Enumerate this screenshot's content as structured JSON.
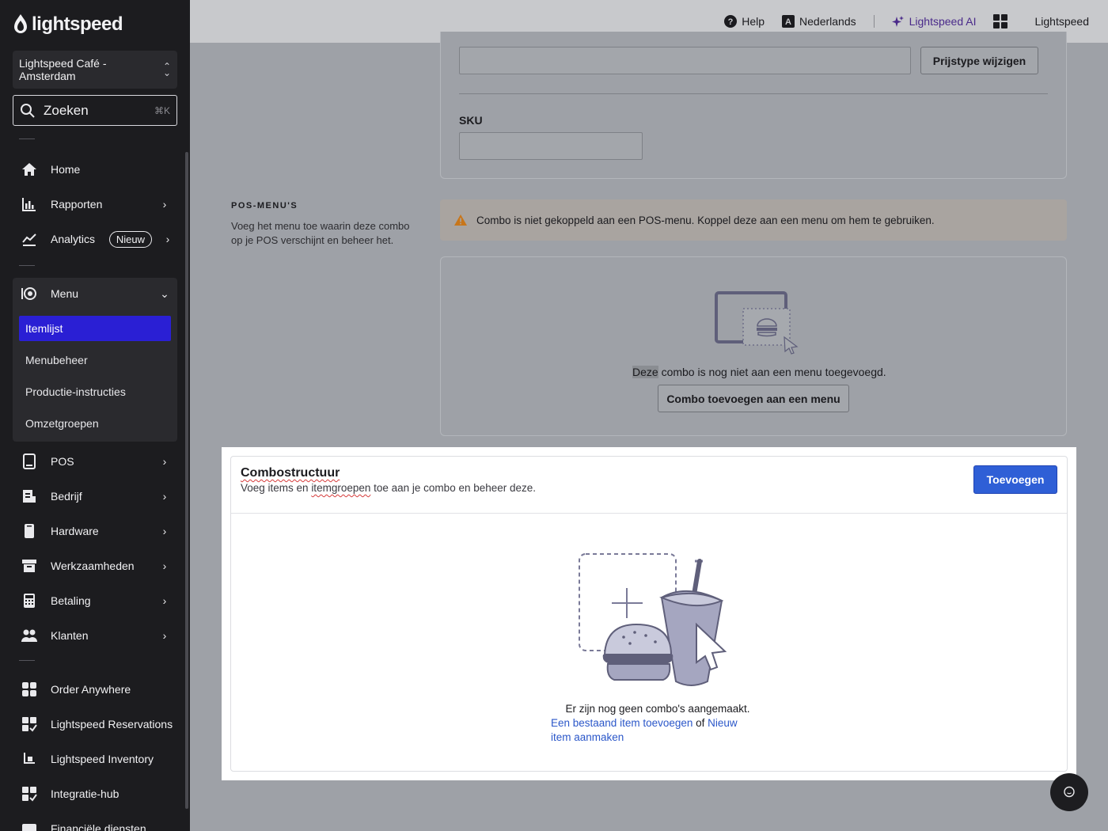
{
  "sidebar": {
    "logo_text": "lightspeed",
    "location": "Lightspeed Café - Amsterdam",
    "search": {
      "label": "Zoeken",
      "shortcut": "⌘K"
    },
    "nav": {
      "home": "Home",
      "rapporten": "Rapporten",
      "analytics": "Analytics",
      "analytics_badge": "Nieuw",
      "menu": "Menu",
      "pos": "POS",
      "bedrijf": "Bedrijf",
      "hardware": "Hardware",
      "werkzaamheden": "Werkzaamheden",
      "betaling": "Betaling",
      "klanten": "Klanten",
      "order_anywhere": "Order Anywhere",
      "reservations": "Lightspeed Reservations",
      "inventory": "Lightspeed Inventory",
      "integratie": "Integratie-hub",
      "financiele": "Financiële diensten"
    },
    "menu_sub": {
      "itemlijst": "Itemlijst",
      "menubeheer": "Menubeheer",
      "productie": "Productie-instructies",
      "omzetgroepen": "Omzetgroepen"
    }
  },
  "topbar": {
    "help": "Help",
    "language": "Nederlands",
    "ai": "Lightspeed AI",
    "account": "Lightspeed"
  },
  "main": {
    "price_button": "Prijstype wijzigen",
    "sku_label": "SKU",
    "pos_menus": {
      "title": "POS-MENU'S",
      "description": "Voeg het menu toe waarin deze combo op je POS verschijnt en beheer het.",
      "warning": "Combo is niet gekoppeld aan een POS-menu. Koppel deze aan een menu om hem te gebruiken.",
      "empty_highlight": "Deze",
      "empty_rest": " combo is nog niet aan een menu toegevoegd.",
      "add_button": "Combo toevoegen aan een menu"
    },
    "combo": {
      "title": "Combostructuur",
      "subtitle_a": "Voeg items en ",
      "subtitle_b": "itemgroepen",
      "subtitle_c": " toe aan je combo en beheer deze.",
      "add_button": "Toevoegen",
      "empty": "Er zijn nog geen combo's aangemaakt.",
      "link_existing": "Een bestaand item toevoegen",
      "or": " of ",
      "link_new": "Nieuw item aanmaken"
    }
  },
  "colors": {
    "sidebar_bg": "#1c1c1f",
    "active_item": "#2a1fd4",
    "primary_button": "#2f5fd6",
    "link": "#2b57c9",
    "ai_purple": "#4a2a8a",
    "warning_icon": "#c8761a"
  }
}
